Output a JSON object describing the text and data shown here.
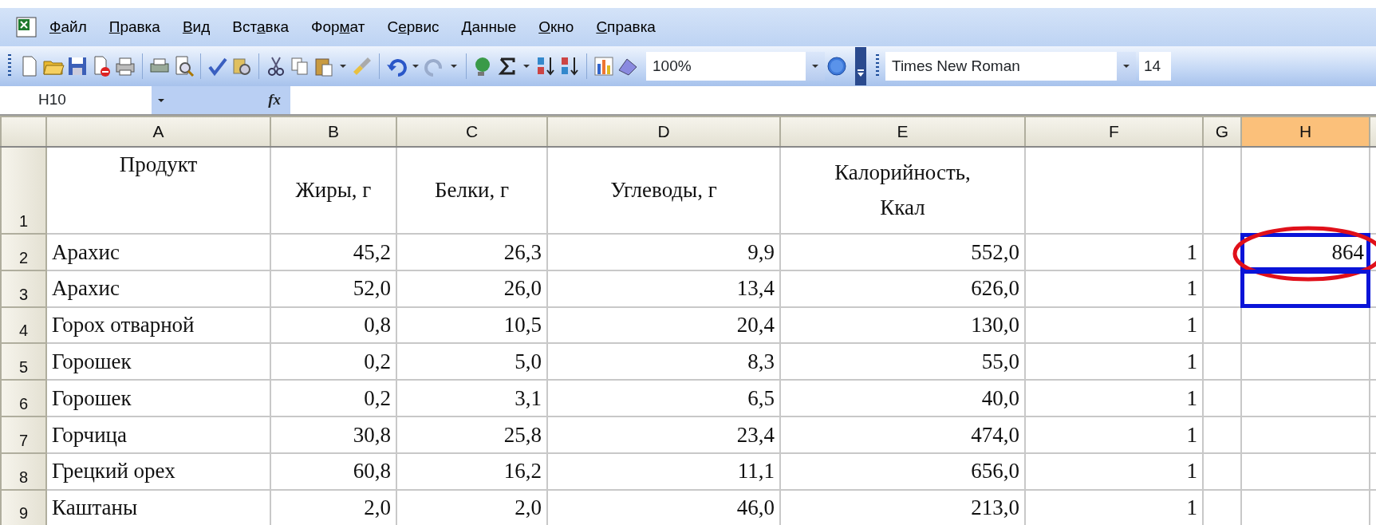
{
  "menu": [
    {
      "key": "Ф",
      "post": "айл"
    },
    {
      "key": "П",
      "post": "равка"
    },
    {
      "key": "В",
      "post": "ид"
    },
    {
      "pre": "Вст",
      "key": "а",
      "post": "вка"
    },
    {
      "pre": "Фор",
      "key": "м",
      "post": "ат"
    },
    {
      "pre": "С",
      "key": "е",
      "post": "рвис"
    },
    {
      "key": "Д",
      "post": "анные"
    },
    {
      "key": "О",
      "post": "кно"
    },
    {
      "key": "С",
      "post": "правка"
    }
  ],
  "toolbar": {
    "zoom": "100%",
    "font": "Times New Roman",
    "font_size": "14"
  },
  "formula_bar": {
    "name_box": "H10",
    "fx": "fx"
  },
  "columns": [
    {
      "label": "A",
      "selected": false
    },
    {
      "label": "B",
      "selected": false
    },
    {
      "label": "C",
      "selected": false
    },
    {
      "label": "D",
      "selected": false
    },
    {
      "label": "E",
      "selected": false
    },
    {
      "label": "F",
      "selected": false
    },
    {
      "label": "G",
      "selected": false
    },
    {
      "label": "H",
      "selected": true
    }
  ],
  "header_row": {
    "header": "1",
    "cells": [
      "Продукт",
      "Жиры, г",
      "Белки, г",
      "Углеводы, г",
      "Калорийность, Ккал",
      null,
      null,
      null
    ]
  },
  "rows": [
    {
      "header": "2",
      "cells": [
        "Арахис",
        "45,2",
        "26,3",
        "9,9",
        "552,0",
        "1",
        null,
        "864"
      ],
      "selected": true,
      "circled": true
    },
    {
      "header": "3",
      "cells": [
        "Арахис",
        "52,0",
        "26,0",
        "13,4",
        "626,0",
        "1",
        null,
        null
      ],
      "selected": true,
      "circled": false
    },
    {
      "header": "4",
      "cells": [
        "Горох отварной",
        "0,8",
        "10,5",
        "20,4",
        "130,0",
        "1",
        null,
        null
      ],
      "selected": false,
      "circled": false
    },
    {
      "header": "5",
      "cells": [
        "Горошек",
        "0,2",
        "5,0",
        "8,3",
        "55,0",
        "1",
        null,
        null
      ],
      "selected": false,
      "circled": false
    },
    {
      "header": "6",
      "cells": [
        "Горошек",
        "0,2",
        "3,1",
        "6,5",
        "40,0",
        "1",
        null,
        null
      ],
      "selected": false,
      "circled": false
    },
    {
      "header": "7",
      "cells": [
        "Горчица",
        "30,8",
        "25,8",
        "23,4",
        "474,0",
        "1",
        null,
        null
      ],
      "selected": false,
      "circled": false
    },
    {
      "header": "8",
      "cells": [
        "Грецкий орех",
        "60,8",
        "16,2",
        "11,1",
        "656,0",
        "1",
        null,
        null
      ],
      "selected": false,
      "circled": false
    },
    {
      "header": "9",
      "cells": [
        "Каштаны",
        "2,0",
        "2,0",
        "46,0",
        "213,0",
        "1",
        null,
        null
      ],
      "selected": false,
      "circled": false
    }
  ]
}
